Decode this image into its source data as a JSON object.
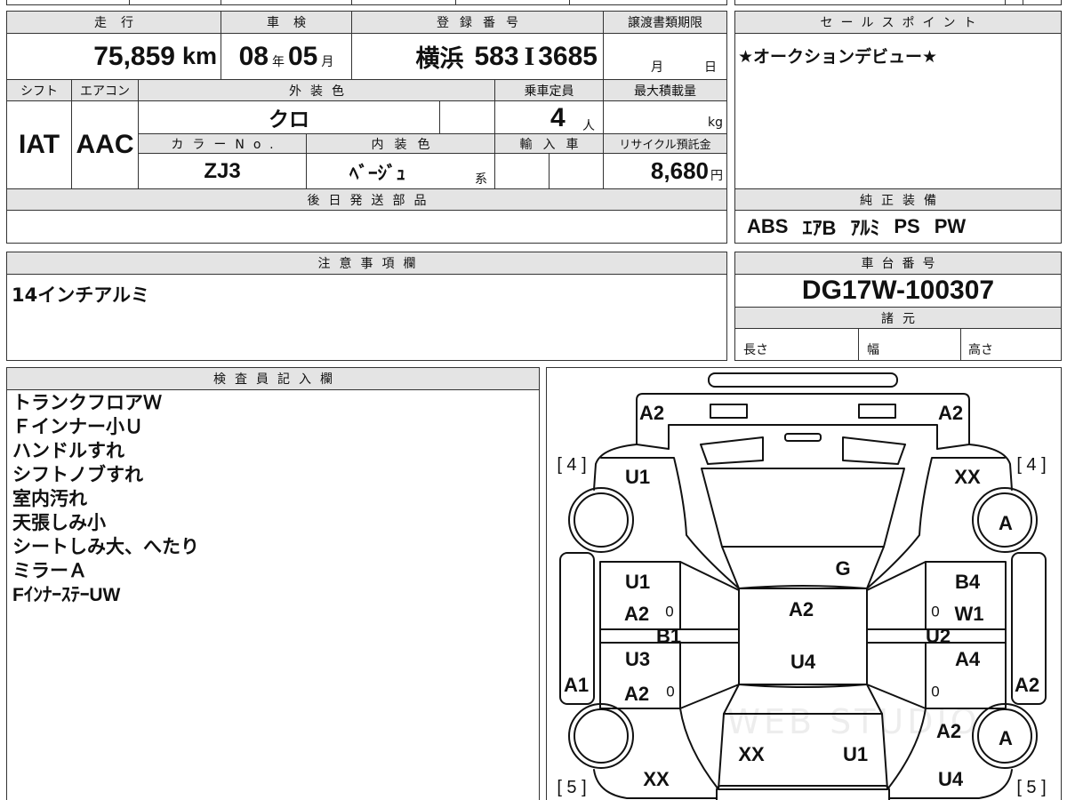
{
  "sheet": {
    "mileage": {
      "label": "走行",
      "value": "75,859",
      "unit": "km"
    },
    "inspection": {
      "label": "車検",
      "year": "08",
      "year_unit": "年",
      "month": "05",
      "month_unit": "月"
    },
    "registration": {
      "label": "登録番号",
      "area": "横浜",
      "class_no": "583",
      "kana": "I",
      "number": "3685"
    },
    "transfer_deadline": {
      "label": "譲渡書類期限",
      "month_unit": "月",
      "day_unit": "日"
    },
    "shift": {
      "label": "シフト",
      "value": "IAT"
    },
    "aircon": {
      "label": "エアコン",
      "value": "AAC"
    },
    "exterior_color": {
      "label": "外装色",
      "value": "クロ"
    },
    "seating_capacity": {
      "label": "乗車定員",
      "value": "4",
      "unit": "人"
    },
    "max_load": {
      "label": "最大積載量",
      "unit": "kg"
    },
    "color_no": {
      "label": "カラーNo.",
      "value": "ZJ3"
    },
    "interior_color": {
      "label": "内装色",
      "value": "ﾍﾞｰｼﾞｭ",
      "suffix": "系"
    },
    "imported": {
      "label": "輸入車"
    },
    "recycle_deposit": {
      "label": "リサイクル預託金",
      "value": "8,680",
      "unit": "円"
    },
    "later_shipping_parts": {
      "label": "後日発送部品"
    }
  },
  "sales_point": {
    "label": "セールスポイント",
    "text": "★オークションデビュー★"
  },
  "standard_equipment": {
    "label": "純正装備",
    "items": [
      "ABS",
      "ｴｱB",
      "ｱﾙﾐ",
      "PS",
      "PW"
    ]
  },
  "notes": {
    "label": "注意事項欄",
    "text": "14インチアルミ"
  },
  "chassis": {
    "label": "車台番号",
    "value": "DG17W-100307"
  },
  "specs": {
    "label": "諸元",
    "length": "長さ",
    "width": "幅",
    "height": "高さ"
  },
  "inspector": {
    "label": "検査員記入欄",
    "lines": [
      "トランクフロアＷ",
      "Ｆインナー小Ｕ",
      "ハンドルすれ",
      "シフトノブすれ",
      "室内汚れ",
      "天張しみ小",
      "シートしみ大、へたり",
      "ミラーＡ",
      "FｲﾝﾅｰｽﾃｰUW"
    ]
  },
  "diagram": {
    "marks": [
      "A2",
      "A2",
      "[ 4 ]",
      "[ 4 ]",
      "U1",
      "XX",
      "A",
      "G",
      "U1",
      "B4",
      "A2",
      "0",
      "A2",
      "0",
      "W1",
      "B1",
      "U2",
      "U3",
      "U4",
      "A4",
      "A1",
      "A2",
      "A2",
      "0",
      "0",
      "A2",
      "A",
      "XX",
      "U1",
      "XX",
      "U4",
      "[ 5 ]",
      "[ 5 ]"
    ],
    "watermark": "WEB STUDIO"
  }
}
